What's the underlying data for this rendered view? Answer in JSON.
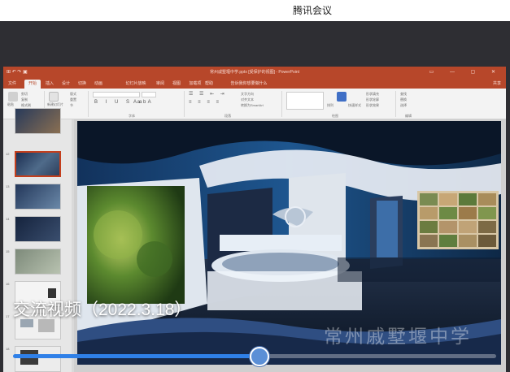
{
  "meeting": {
    "window_title": "腾讯会议"
  },
  "ppt": {
    "doc_title": "常州戚墅堰中学.pptx [受保护的视图] - PowerPoint",
    "qat": "⊞ ↶ ↷ ▣",
    "window_controls": "▭ — ▢ ✕",
    "tabs": [
      "文件",
      "开始",
      "插入",
      "设计",
      "切换",
      "动画",
      "幻灯片放映",
      "审阅",
      "视图",
      "加载项",
      "帮助",
      "告诉我你想要做什么"
    ],
    "share_label": "共享",
    "ribbon": {
      "clipboard_label": "剪贴板",
      "font_label": "字体",
      "paragraph_label": "段落",
      "drawing_label": "绘图",
      "editing_label": "编辑",
      "paste": "粘贴",
      "cut": "剪切",
      "copy": "复制",
      "format_painter": "格式刷",
      "new_slide": "新建幻灯片",
      "layout": "版式",
      "reset": "重置",
      "section": "节",
      "find": "查找",
      "replace": "替换",
      "select": "选择",
      "text_direction": "文字方向",
      "align_text": "对齐文本",
      "smartart": "转换为SmartArt",
      "arrange": "排列",
      "quick_styles": "快速样式",
      "shape_fill": "形状填充",
      "shape_outline": "形状轮廓",
      "shape_effects": "形状效果"
    },
    "slide_numbers": [
      "",
      "12",
      "13",
      "14",
      "15",
      "16",
      "17",
      "18"
    ]
  },
  "video": {
    "title": "交流视频（2022.3.18）",
    "watermark": "常州戚墅堰中学",
    "progress": 0.51,
    "colors": {
      "accent": "#2f80e8",
      "ppt_brand": "#b7472a"
    }
  }
}
